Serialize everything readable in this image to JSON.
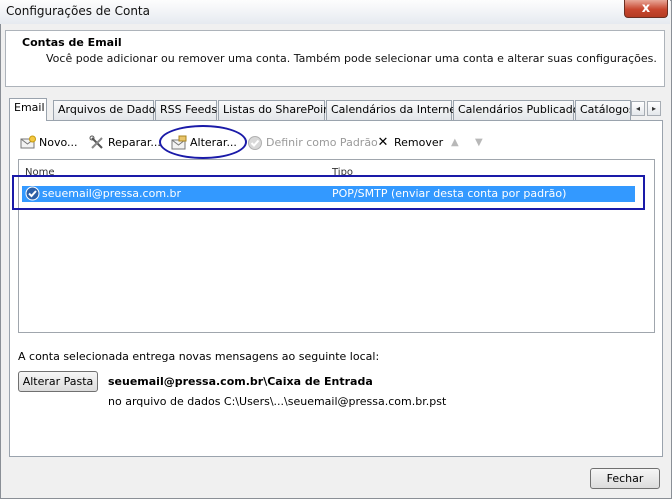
{
  "window": {
    "title": "Configurações de Conta",
    "close_glyph": "x"
  },
  "header": {
    "title": "Contas de Email",
    "description": "Você pode adicionar ou remover uma conta. Também pode selecionar uma conta e alterar suas configurações."
  },
  "tabs": [
    {
      "label": "Email",
      "active": true
    },
    {
      "label": "Arquivos de Dados"
    },
    {
      "label": "RSS Feeds"
    },
    {
      "label": "Listas do SharePoint"
    },
    {
      "label": "Calendários da Internet"
    },
    {
      "label": "Calendários Publicados"
    },
    {
      "label": "Catálogos"
    }
  ],
  "tab_scroll": {
    "left": "◂",
    "right": "▸"
  },
  "toolbar": {
    "new_label": "Novo...",
    "repair_label": "Reparar...",
    "change_label": "Alterar...",
    "set_default_label": "Definir como Padrão",
    "remove_label": "Remover",
    "remove_glyph": "✕",
    "move_up_glyph": "▲",
    "move_down_glyph": "▼"
  },
  "accounts_list": {
    "columns": {
      "name": "Nome",
      "type": "Tipo"
    },
    "rows": [
      {
        "name": "seuemail@pressa.com.br",
        "type": "POP/SMTP (enviar desta conta por padrão)",
        "selected": true
      }
    ]
  },
  "delivery": {
    "description": "A conta selecionada entrega novas mensagens ao seguinte local:",
    "change_folder_label": "Alterar Pasta",
    "location": "seuemail@pressa.com.br\\Caixa de Entrada",
    "data_file": "no arquivo de dados C:\\Users\\...\\seuemail@pressa.com.br.pst"
  },
  "footer": {
    "close_label": "Fechar"
  },
  "colors": {
    "selection": "#3399ff",
    "annotation": "#1a1aa8",
    "close_button": "#c8472f"
  }
}
